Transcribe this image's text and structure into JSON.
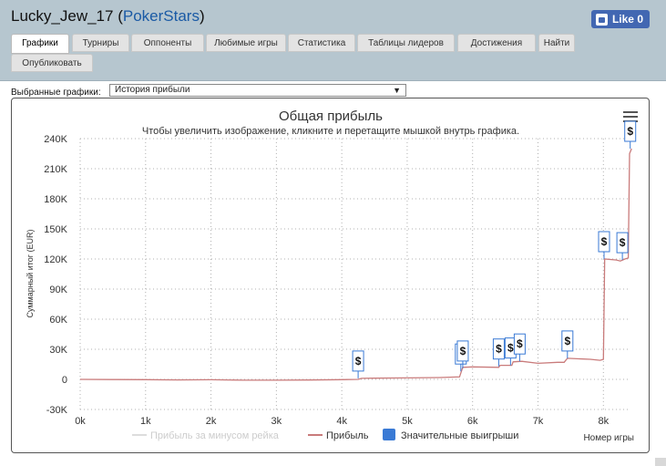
{
  "header": {
    "title_user": "Lucky_Jew_17",
    "title_open": " (",
    "title_site": "PokerStars",
    "title_close": ")",
    "like_label": "Like 0"
  },
  "tabs": [
    {
      "label": "Графики",
      "active": true
    },
    {
      "label": "Турниры"
    },
    {
      "label": "Оппоненты"
    },
    {
      "label": "Любимые игры"
    },
    {
      "label": "Статистика"
    },
    {
      "label": "Таблицы лидеров"
    },
    {
      "label": "Достижения"
    },
    {
      "label": "Найти"
    },
    {
      "label": "Опубликовать"
    }
  ],
  "selector": {
    "label": "Выбранные графики:",
    "value": "История прибыли"
  },
  "chart_data": {
    "type": "line",
    "title": "Общая прибыль",
    "subtitle": "Чтобы увеличить изображение, кликните и перетащите мышкой внутрь графика.",
    "ylabel": "Суммарный итог (EUR)",
    "xlabel": "Номер игры",
    "ylim": [
      -30000,
      240000
    ],
    "xlim": [
      0,
      8400
    ],
    "y_ticks": [
      "240K",
      "210K",
      "180K",
      "150K",
      "120K",
      "90K",
      "60K",
      "30K",
      "0",
      "-30K"
    ],
    "x_ticks": [
      "0k",
      "1k",
      "2k",
      "3k",
      "4k",
      "5k",
      "6k",
      "7k",
      "8k"
    ],
    "series": [
      {
        "name": "Прибыль за минусом рейка",
        "color": "#dddddd",
        "hidden": true
      },
      {
        "name": "Прибыль",
        "color": "#c97b7b",
        "points": [
          [
            0,
            0
          ],
          [
            500,
            -200
          ],
          [
            1000,
            -300
          ],
          [
            1500,
            -500
          ],
          [
            2000,
            -400
          ],
          [
            2500,
            -800
          ],
          [
            3000,
            -800
          ],
          [
            3500,
            -600
          ],
          [
            4000,
            -300
          ],
          [
            4250,
            0
          ],
          [
            4300,
            1000
          ],
          [
            4500,
            1200
          ],
          [
            5000,
            1500
          ],
          [
            5500,
            1800
          ],
          [
            5800,
            2500
          ],
          [
            5850,
            12000
          ],
          [
            6000,
            12500
          ],
          [
            6400,
            12000
          ],
          [
            6420,
            14000
          ],
          [
            6600,
            14000
          ],
          [
            6620,
            17500
          ],
          [
            6750,
            18000
          ],
          [
            7000,
            16000
          ],
          [
            7300,
            17000
          ],
          [
            7400,
            17000
          ],
          [
            7450,
            21000
          ],
          [
            7800,
            20000
          ],
          [
            7950,
            19000
          ],
          [
            8000,
            20000
          ],
          [
            8020,
            120000
          ],
          [
            8200,
            119000
          ],
          [
            8260,
            118000
          ],
          [
            8330,
            120000
          ],
          [
            8380,
            121000
          ],
          [
            8400,
            225000
          ],
          [
            8430,
            230000
          ]
        ]
      },
      {
        "name": "Значительные выигрыши",
        "color": "#3a7ad5",
        "marker_label": "$",
        "points": [
          [
            4250,
            1000
          ],
          [
            5820,
            8000
          ],
          [
            5850,
            11000
          ],
          [
            6400,
            13000
          ],
          [
            6580,
            14000
          ],
          [
            6720,
            18000
          ],
          [
            7450,
            21000
          ],
          [
            8010,
            120000
          ],
          [
            8290,
            119000
          ],
          [
            8410,
            230000
          ]
        ]
      }
    ],
    "legend_position": "bottom-center"
  }
}
